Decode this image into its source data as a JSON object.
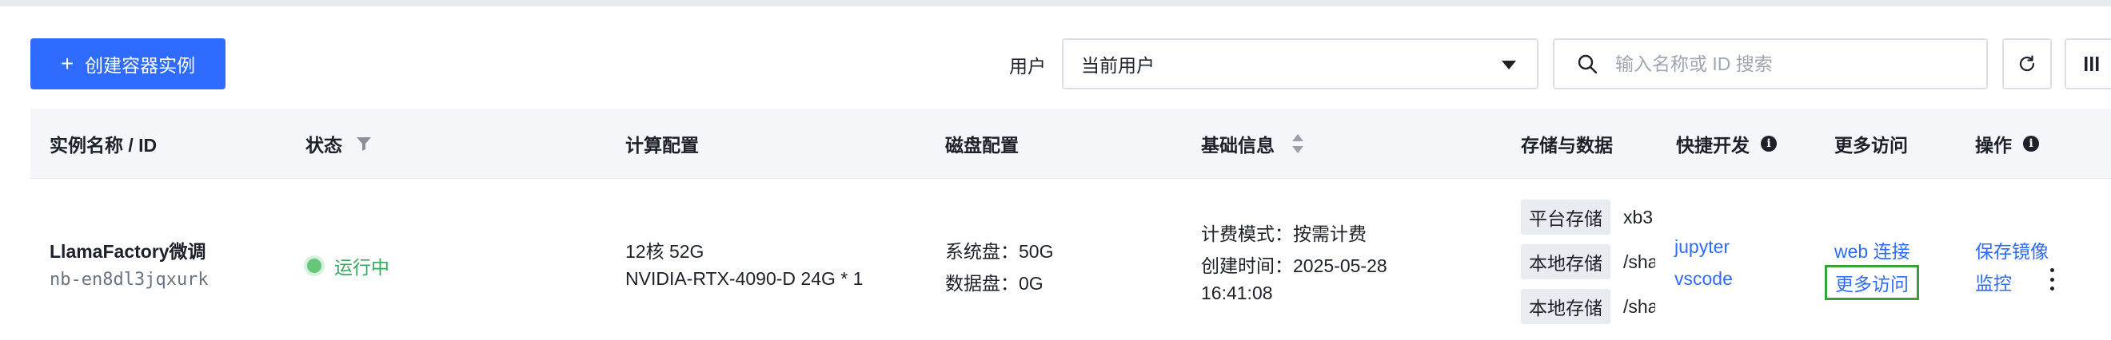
{
  "toolbar": {
    "create_button_label": "创建容器实例",
    "user_filter_label": "用户",
    "user_filter_value": "当前用户",
    "search_placeholder": "输入名称或 ID 搜索"
  },
  "table": {
    "headers": {
      "name": "实例名称 / ID",
      "status": "状态",
      "compute": "计算配置",
      "disk": "磁盘配置",
      "basic": "基础信息",
      "storage": "存储与数据",
      "quick_dev": "快捷开发",
      "more_access": "更多访问",
      "actions": "操作"
    },
    "rows": [
      {
        "name": "LlamaFactory微调",
        "id": "nb-en8dl3jqxurk",
        "status": "运行中",
        "compute_line1": "12核 52G",
        "compute_line2": "NVIDIA-RTX-4090-D 24G * 1",
        "disk_line1": "系统盘：50G",
        "disk_line2": "数据盘：0G",
        "billing": "计费模式：按需计费",
        "created_label": "创建时间：2025-05-28",
        "created_time": "16:41:08",
        "storage": [
          {
            "tag": "平台存储",
            "value": "xb3"
          },
          {
            "tag": "本地存储",
            "value": "/sha"
          },
          {
            "tag": "本地存储",
            "value": "/sha"
          }
        ],
        "quick_dev": [
          "jupyter",
          "vscode"
        ],
        "more_access": [
          "web 连接",
          "更多访问"
        ],
        "actions": [
          "保存镜像",
          "监控"
        ]
      }
    ]
  },
  "colors": {
    "primary": "#2f6bff",
    "running": "#3aa65f",
    "highlight_border": "#3aa13a",
    "header_bg": "#f4f6fa"
  }
}
